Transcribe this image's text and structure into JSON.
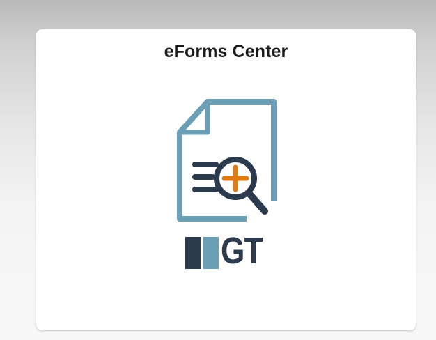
{
  "tile": {
    "title": "eForms Center",
    "icon": "document-search-plus-icon",
    "brand_text": "GT"
  },
  "colors": {
    "doc_outline": "#6a9fb5",
    "magnifier": "#2b3a4d",
    "plus": "#e07b14",
    "brand_dark": "#2b3a4d",
    "brand_light": "#6a9fb5"
  }
}
